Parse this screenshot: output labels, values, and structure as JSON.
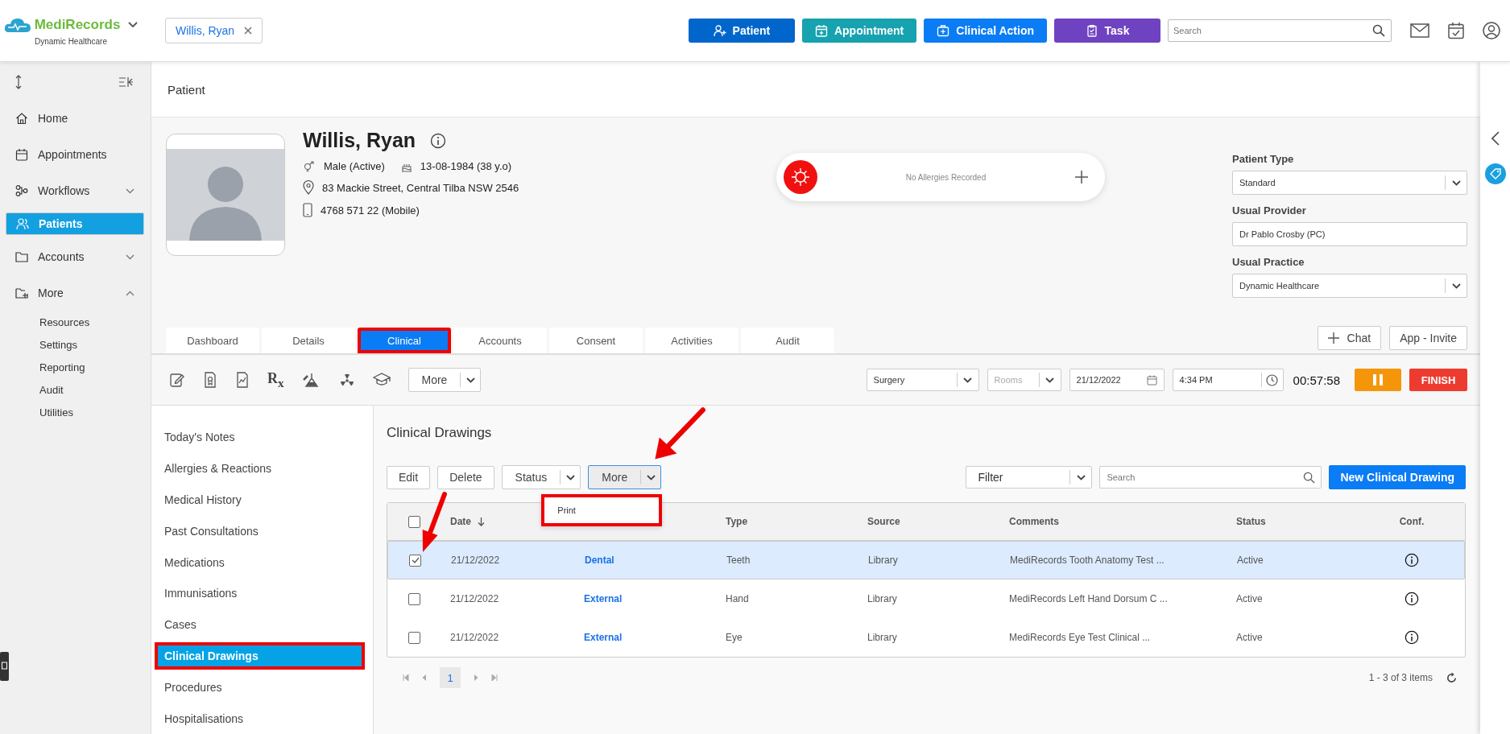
{
  "topbar": {
    "logo": "MediRecords",
    "practice": "Dynamic Healthcare",
    "open_tab": "Willis, Ryan",
    "actions": [
      {
        "label": "Patient",
        "kind": "patient",
        "color": "#0066cc"
      },
      {
        "label": "Appointment",
        "kind": "appointment",
        "color": "#17a2b0"
      },
      {
        "label": "Clinical Action",
        "kind": "clinical",
        "color": "#0a7cf5"
      },
      {
        "label": "Task",
        "kind": "task",
        "color": "#6f42c1"
      }
    ],
    "search_placeholder": "Search"
  },
  "sidebar": {
    "items": [
      {
        "label": "Home",
        "kind": "home",
        "selected": false
      },
      {
        "label": "Appointments",
        "kind": "calendar",
        "selected": false
      },
      {
        "label": "Workflows",
        "kind": "workflow",
        "selected": false,
        "expanded": false
      },
      {
        "label": "Patients",
        "kind": "patients",
        "selected": true
      },
      {
        "label": "Accounts",
        "kind": "folder",
        "selected": false,
        "expanded": false
      },
      {
        "label": "More",
        "kind": "more",
        "selected": false,
        "expanded": true,
        "children": [
          {
            "label": "Resources"
          },
          {
            "label": "Settings"
          },
          {
            "label": "Reporting"
          },
          {
            "label": "Audit"
          },
          {
            "label": "Utilities"
          }
        ]
      }
    ]
  },
  "page_title": "Patient",
  "patient": {
    "name": "Willis, Ryan",
    "gender": "Male (Active)",
    "dob": "13-08-1984 (38 y.o)",
    "address": "83 Mackie Street, Central Tilba NSW 2546",
    "phone": "4768 571 22 (Mobile)",
    "allergies": "No Allergies Recorded",
    "fields": [
      {
        "label": "Patient Type",
        "value": "Standard",
        "kind": "select"
      },
      {
        "label": "Usual Provider",
        "value": "Dr Pablo Crosby (PC)",
        "kind": "text"
      },
      {
        "label": "Usual Practice",
        "value": "Dynamic Healthcare",
        "kind": "select"
      }
    ],
    "buttons": [
      {
        "label": "Chat",
        "kind": "add"
      },
      {
        "label": "App - Invite",
        "kind": "plain"
      }
    ]
  },
  "tabs": [
    {
      "label": "Dashboard",
      "selected": false,
      "highlighted": false
    },
    {
      "label": "Details",
      "selected": false,
      "highlighted": false
    },
    {
      "label": "Clinical",
      "selected": true,
      "highlighted": true
    },
    {
      "label": "Accounts",
      "selected": false,
      "highlighted": false
    },
    {
      "label": "Consent",
      "selected": false,
      "highlighted": false
    },
    {
      "label": "Activities",
      "selected": false,
      "highlighted": false
    },
    {
      "label": "Audit",
      "selected": false,
      "highlighted": false
    }
  ],
  "toolbar": {
    "rx": "R$_{x}$",
    "more": "More",
    "location": "Surgery",
    "rooms_placeholder": "Rooms",
    "date": "21/12/2022",
    "time": "4:34 PM",
    "timer": "00:57:58",
    "finish": "FINISH"
  },
  "clinical_nav": [
    {
      "label": "Today's Notes",
      "selected": false,
      "highlighted": false
    },
    {
      "label": "Allergies & Reactions",
      "selected": false,
      "highlighted": false
    },
    {
      "label": "Medical History",
      "selected": false,
      "highlighted": false
    },
    {
      "label": "Past Consultations",
      "selected": false,
      "highlighted": false
    },
    {
      "label": "Medications",
      "selected": false,
      "highlighted": false
    },
    {
      "label": "Immunisations",
      "selected": false,
      "highlighted": false
    },
    {
      "label": "Cases",
      "selected": false,
      "highlighted": false
    },
    {
      "label": "Clinical Drawings",
      "selected": true,
      "highlighted": true
    },
    {
      "label": "Procedures",
      "selected": false,
      "highlighted": false
    },
    {
      "label": "Hospitalisations",
      "selected": false,
      "highlighted": false
    }
  ],
  "drawings": {
    "title": "Clinical Drawings",
    "edit": "Edit",
    "delete": "Delete",
    "status": "Status",
    "more": "More",
    "menu": [
      {
        "label": "Print",
        "highlighted": true
      }
    ],
    "filter": "Filter",
    "search_placeholder": "Search",
    "new_button": "New Clinical Drawing",
    "table": {
      "all_checked": false,
      "columns": [
        {
          "label": "Date",
          "sorted": true
        },
        {
          "label": "Type"
        },
        {
          "label": "Source"
        },
        {
          "label": "Comments"
        },
        {
          "label": "Status"
        },
        {
          "label": "Conf."
        }
      ],
      "rows": [
        {
          "selected": true,
          "date": "21/12/2022",
          "column_2": "Dental",
          "type": "Teeth",
          "source": "Library",
          "comments": "MediRecords Tooth Anatomy Test ...",
          "status": "Active"
        },
        {
          "selected": false,
          "date": "21/12/2022",
          "column_2": "External",
          "type": "Hand",
          "source": "Library",
          "comments": "MediRecords Left Hand Dorsum C ...",
          "status": "Active"
        },
        {
          "selected": false,
          "date": "21/12/2022",
          "column_2": "External",
          "type": "Eye",
          "source": "Library",
          "comments": "MediRecords Eye Test Clinical ...",
          "status": "Active"
        }
      ]
    },
    "pages": [
      {
        "label": "1",
        "selected": true
      }
    ],
    "summary": "1 - 3 of 3 items"
  }
}
